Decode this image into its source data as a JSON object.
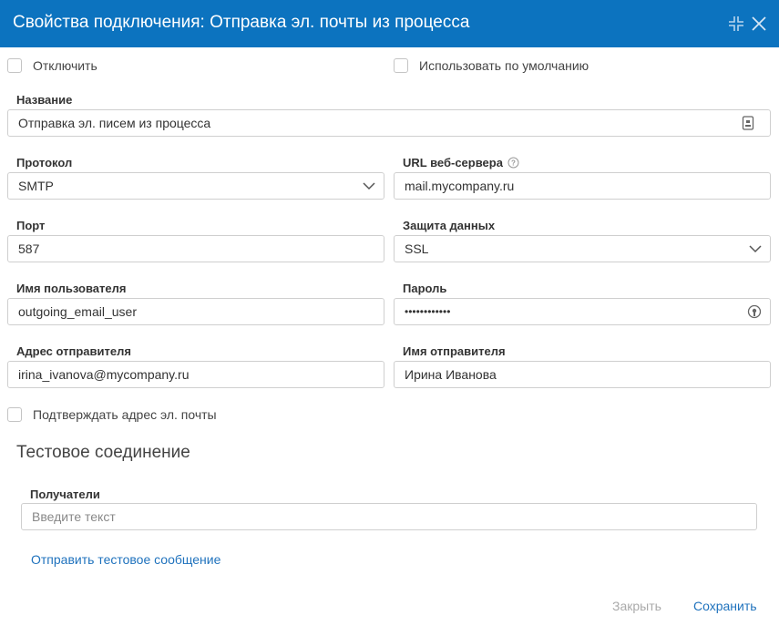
{
  "dialog": {
    "title": "Свойства подключения: Отправка эл. почты из процесса"
  },
  "checkboxes": {
    "disable": {
      "label": "Отключить",
      "checked": false
    },
    "use_default": {
      "label": "Использовать по умолчанию",
      "checked": false
    },
    "confirm_email": {
      "label": "Подтверждать адрес эл. почты",
      "checked": false
    }
  },
  "fields": {
    "name": {
      "label": "Название",
      "value": "Отправка эл. писем из процесса"
    },
    "protocol": {
      "label": "Протокол",
      "value": "SMTP"
    },
    "server_url": {
      "label": "URL веб-сервера",
      "value": "mail.mycompany.ru"
    },
    "port": {
      "label": "Порт",
      "value": "587"
    },
    "security": {
      "label": "Защита данных",
      "value": "SSL"
    },
    "username": {
      "label": "Имя пользователя",
      "value": "outgoing_email_user"
    },
    "password": {
      "label": "Пароль",
      "value": "••••••••••••"
    },
    "sender_address": {
      "label": "Адрес отправителя",
      "value": "irina_ivanova@mycompany.ru"
    },
    "sender_name": {
      "label": "Имя отправителя",
      "value": "Ирина Иванова"
    }
  },
  "test": {
    "section_title": "Тестовое соединение",
    "recipients_label": "Получатели",
    "recipients_placeholder": "Введите текст",
    "send_test_link": "Отправить тестовое сообщение"
  },
  "footer": {
    "close_label": "Закрыть",
    "save_label": "Сохранить"
  },
  "colors": {
    "header_bg": "#0c73bf",
    "link": "#1f72bd"
  }
}
